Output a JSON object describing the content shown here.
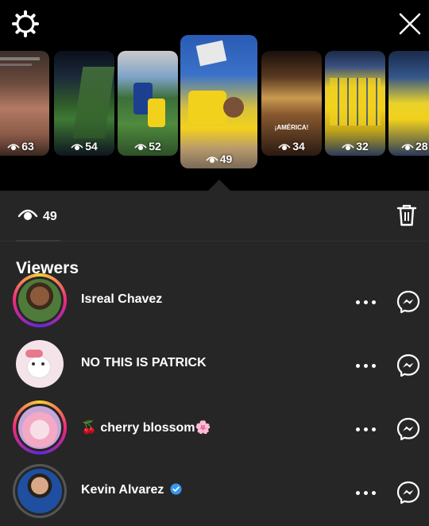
{
  "story_tray": {
    "counts": [
      "63",
      "54",
      "52",
      "49",
      "34",
      "32",
      "28"
    ],
    "thumb_overlay_text": "¡AMÉRICA!"
  },
  "stats": {
    "view_count": "49"
  },
  "viewers": {
    "title": "Viewers",
    "items": [
      {
        "name": "Isreal Chavez",
        "ring": "gradient",
        "verified": false
      },
      {
        "name": "NO THIS IS PATRICK",
        "ring": "none",
        "verified": false
      },
      {
        "name": "🍒 cherry blossom🌸",
        "ring": "gradient",
        "verified": false
      },
      {
        "name": "Kevin Alvarez",
        "ring": "gray",
        "verified": true
      }
    ]
  },
  "colors": {
    "background": "#000000",
    "sheet": "#262626",
    "text": "#ffffff",
    "verified": "#3797f0",
    "ring_start": "#f9ce34",
    "ring_mid": "#ee2a7b",
    "ring_end": "#6228d7"
  },
  "icons": [
    "gear-icon",
    "close-icon",
    "eye-icon",
    "trash-icon",
    "more-icon",
    "messenger-icon",
    "verified-badge-icon"
  ]
}
